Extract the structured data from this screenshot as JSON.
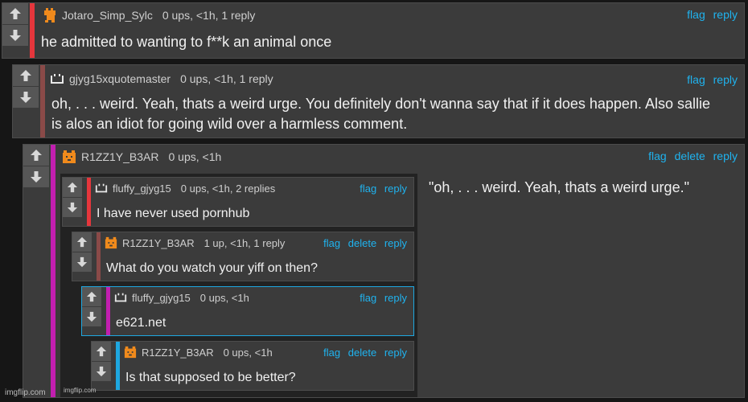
{
  "comments": [
    {
      "user": "Jotaro_Simp_Sylc",
      "meta": "0 ups, <1h, 1 reply",
      "text": "he admitted to wanting to f**k an animal once",
      "actions": [
        "flag",
        "reply"
      ]
    },
    {
      "user": "gjyg15xquotemaster",
      "meta": "0 ups, <1h, 1 reply",
      "text_line1": "oh, . . . weird. Yeah, thats a weird urge. You definitely don't wanna say that if it does happen. Also sallie",
      "text_line2": "is alos an idiot for going wild over a harmless comment.",
      "actions": [
        "flag",
        "reply"
      ]
    },
    {
      "user": "R1ZZ1Y_B3AR",
      "meta": "0 ups, <1h",
      "quote": "\"oh, . . . weird. Yeah, thats a weird urge.\"",
      "actions": [
        "flag",
        "delete",
        "reply"
      ]
    }
  ],
  "embedded": [
    {
      "user": "fluffy_gjyg15",
      "meta": "0 ups, <1h, 2 replies",
      "text": "I have never used pornhub",
      "actions": [
        "flag",
        "reply"
      ]
    },
    {
      "user": "R1ZZ1Y_B3AR",
      "meta": "1 up, <1h, 1 reply",
      "text": "What do you watch your yiff on then?",
      "actions": [
        "flag",
        "delete",
        "reply"
      ]
    },
    {
      "user": "fluffy_gjyg15",
      "meta": "0 ups, <1h",
      "text": "e621.net",
      "actions": [
        "flag",
        "reply"
      ]
    },
    {
      "user": "R1ZZ1Y_B3AR",
      "meta": "0 ups, <1h",
      "text": "Is that supposed to be better?",
      "actions": [
        "flag",
        "delete",
        "reply"
      ]
    }
  ],
  "embed_footer": "imgflip.com",
  "watermark": "imgflip.com",
  "colors": {
    "bar_red": "#e5363c",
    "bar_brown": "#8a4a48",
    "bar_magenta": "#c21fb0",
    "bar_cyan": "#1ea7e0",
    "link": "#1fb3ef",
    "avatar_orange": "#f08a1c"
  }
}
